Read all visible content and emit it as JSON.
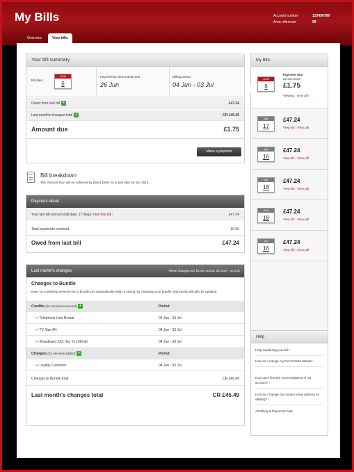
{
  "header": {
    "title": "My Bills",
    "account_number_label": "Account number",
    "account_number": "123456789",
    "area_reference_label": "Area reference",
    "area_reference": "99"
  },
  "tabs": [
    {
      "label": "Overview",
      "active": false
    },
    {
      "label": "View bills",
      "active": true
    }
  ],
  "summary": {
    "heading": "Your bill summary",
    "bill_date_label": "Bill date:",
    "bill_date_month": "JUNE",
    "bill_date_day": "6",
    "dd_due_label": "Payment by Direct Debit due:",
    "dd_due_value": "26 Jun",
    "billing_period_label": "Billing period:",
    "billing_period_value": "04 Jun - 03 Jul",
    "owed_label": "Owed from last bill",
    "owed_value": "£47.24",
    "changes_label": "Last month's changes total",
    "changes_value": "CR £45.49",
    "amount_due_label": "Amount due",
    "amount_due_value": "£1.75",
    "make_payment": "Make a payment"
  },
  "breakdown": {
    "title": "Bill breakdown",
    "note": "The 'Amount Due' will be collected by Direct Debit on or just after 26 Jun 2013."
  },
  "payment_detail": {
    "heading": "Payment detail",
    "last_bill_label": "Your last bill amount (bill date: 17 May)",
    "view_this_bill": "View this bill",
    "last_bill_value": "£47.24",
    "total_payments_label": "Total payments received",
    "total_payments_value": "£0.00",
    "owed_label": "Owed from last bill",
    "owed_value": "£47.24"
  },
  "changes": {
    "heading": "Last month's changes",
    "period_note": "These changes are for the period: 04 June - 03 July",
    "bundle_title": "Changes to Bundle",
    "bundle_note": "Note: by combining services into a bundle you automatically enjoy a saving. By changing your bundle, that saving will also be updated.",
    "credits_label": "Credits",
    "credits_sub": "(for services removed)",
    "period_col": "Period",
    "credits": [
      {
        "name": "Telephone Line Rental",
        "period": "04 Jun - 03 Jul"
      },
      {
        "name": "TV Size M+",
        "period": "04 Jun - 03 Jul"
      },
      {
        "name": "Broadband XXL (Up To 100mb)",
        "period": "04 Jun - 03 Jul"
      }
    ],
    "charges_label": "Charges",
    "charges_sub": "(for services added)",
    "charges": [
      {
        "name": "Loyalty Customer",
        "period": "04 Jun - 03 Jul"
      }
    ],
    "bundle_total_label": "Changes to Bundle total",
    "bundle_total_value": "CR £45.49",
    "changes_total_label": "Last month's changes total",
    "changes_total_value": "CR £45.49"
  },
  "my_bills": {
    "heading": "My Bills",
    "current": {
      "month": "JUNE",
      "day": "6",
      "due_label": "Payment due:",
      "due_date": "26 Jun 2013",
      "amount": "£1.75",
      "viewing": "Viewing",
      "view_pdf": "View pdf"
    },
    "items": [
      {
        "month": "May",
        "day": "17",
        "amount": "£47.24",
        "view_bill": "View bill",
        "view_pdf": "View pdf"
      },
      {
        "month": "Apr",
        "day": "16",
        "amount": "£47.24",
        "view_bill": "View bill",
        "view_pdf": "View pdf"
      },
      {
        "month": "Mar",
        "day": "18",
        "amount": "£47.24",
        "view_bill": "View bill",
        "view_pdf": "View pdf"
      },
      {
        "month": "Feb",
        "day": "18",
        "amount": "£47.24",
        "view_bill": "View bill",
        "view_pdf": "View pdf"
      },
      {
        "month": "Jan",
        "day": "16",
        "amount": "£47.24",
        "view_bill": "View bill",
        "view_pdf": "View pdf"
      }
    ]
  },
  "help": {
    "heading": "Help",
    "links": [
      "Help explaining your bill",
      "How do I change my Direct Debit details?",
      "How can I find the current balance of my account?",
      "How do I change my contact email address for eBilling?",
      "All Billing & Payments help"
    ]
  }
}
